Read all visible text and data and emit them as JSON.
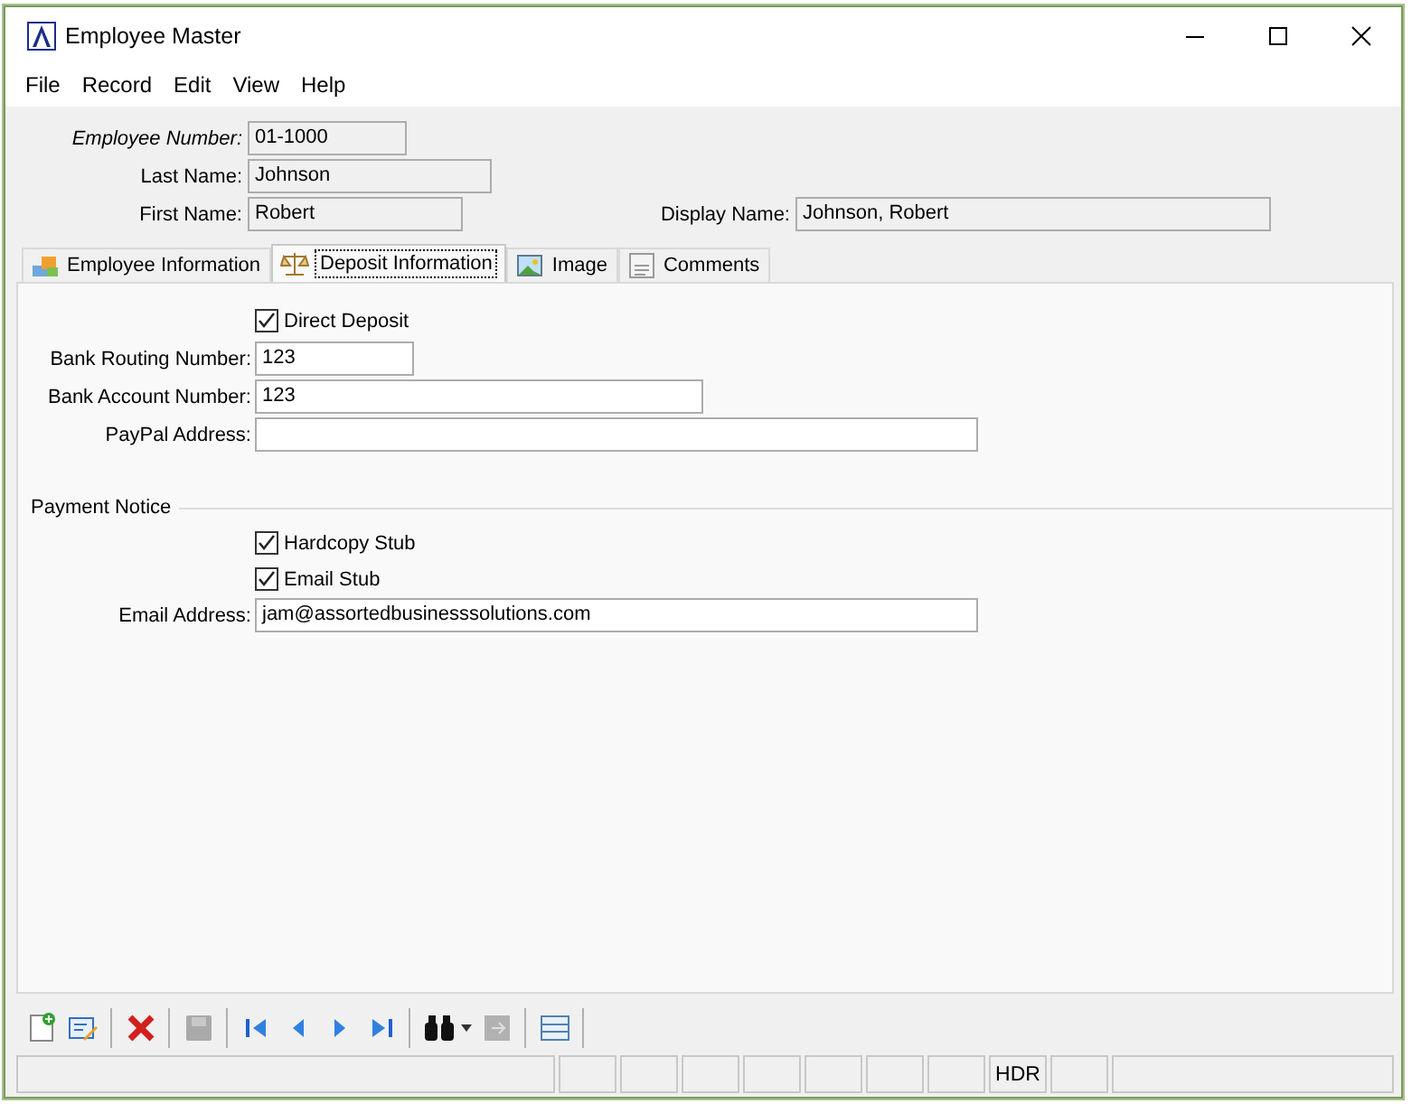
{
  "window": {
    "title": "Employee Master"
  },
  "menu": [
    "File",
    "Record",
    "Edit",
    "View",
    "Help"
  ],
  "header": {
    "employee_number": {
      "label": "Employee Number:",
      "value": "01-1000"
    },
    "last_name": {
      "label": "Last Name:",
      "value": "Johnson"
    },
    "first_name": {
      "label": "First Name:",
      "value": "Robert"
    },
    "display_name": {
      "label": "Display Name:",
      "value": "Johnson, Robert"
    }
  },
  "tabs": [
    {
      "label": "Employee Information",
      "selected": false
    },
    {
      "label": "Deposit Information",
      "selected": true
    },
    {
      "label": "Image",
      "selected": false
    },
    {
      "label": "Comments",
      "selected": false
    }
  ],
  "deposit": {
    "direct_deposit": {
      "label": "Direct Deposit",
      "checked": true
    },
    "fields": [
      {
        "label": "Bank Routing Number:",
        "value": "123"
      },
      {
        "label": "Bank Account Number:",
        "value": "123"
      },
      {
        "label": "PayPal Address:"
      }
    ]
  },
  "payment_notice": {
    "title": "Payment Notice",
    "checks": [
      {
        "label": "Hardcopy Stub",
        "checked": true
      },
      {
        "label": "Email Stub",
        "checked": true
      }
    ],
    "email": {
      "label": "Email Address:",
      "value": "jam@assortedbusinesssolutions.com"
    }
  },
  "toolbar": [
    {
      "items": [
        {
          "disabled": false
        },
        {
          "disabled": false
        }
      ]
    },
    {
      "items": [
        {
          "disabled": false
        }
      ]
    },
    {
      "items": [
        {
          "disabled": true
        }
      ]
    },
    {
      "items": [
        {
          "disabled": false
        },
        {
          "disabled": false
        },
        {
          "disabled": false
        },
        {
          "disabled": false
        }
      ]
    },
    {
      "items": [
        {
          "disabled": false
        },
        {
          "disabled": true
        }
      ]
    },
    {
      "items": [
        {
          "disabled": false
        }
      ]
    }
  ],
  "status_bar": {
    "indicator": "HDR"
  }
}
